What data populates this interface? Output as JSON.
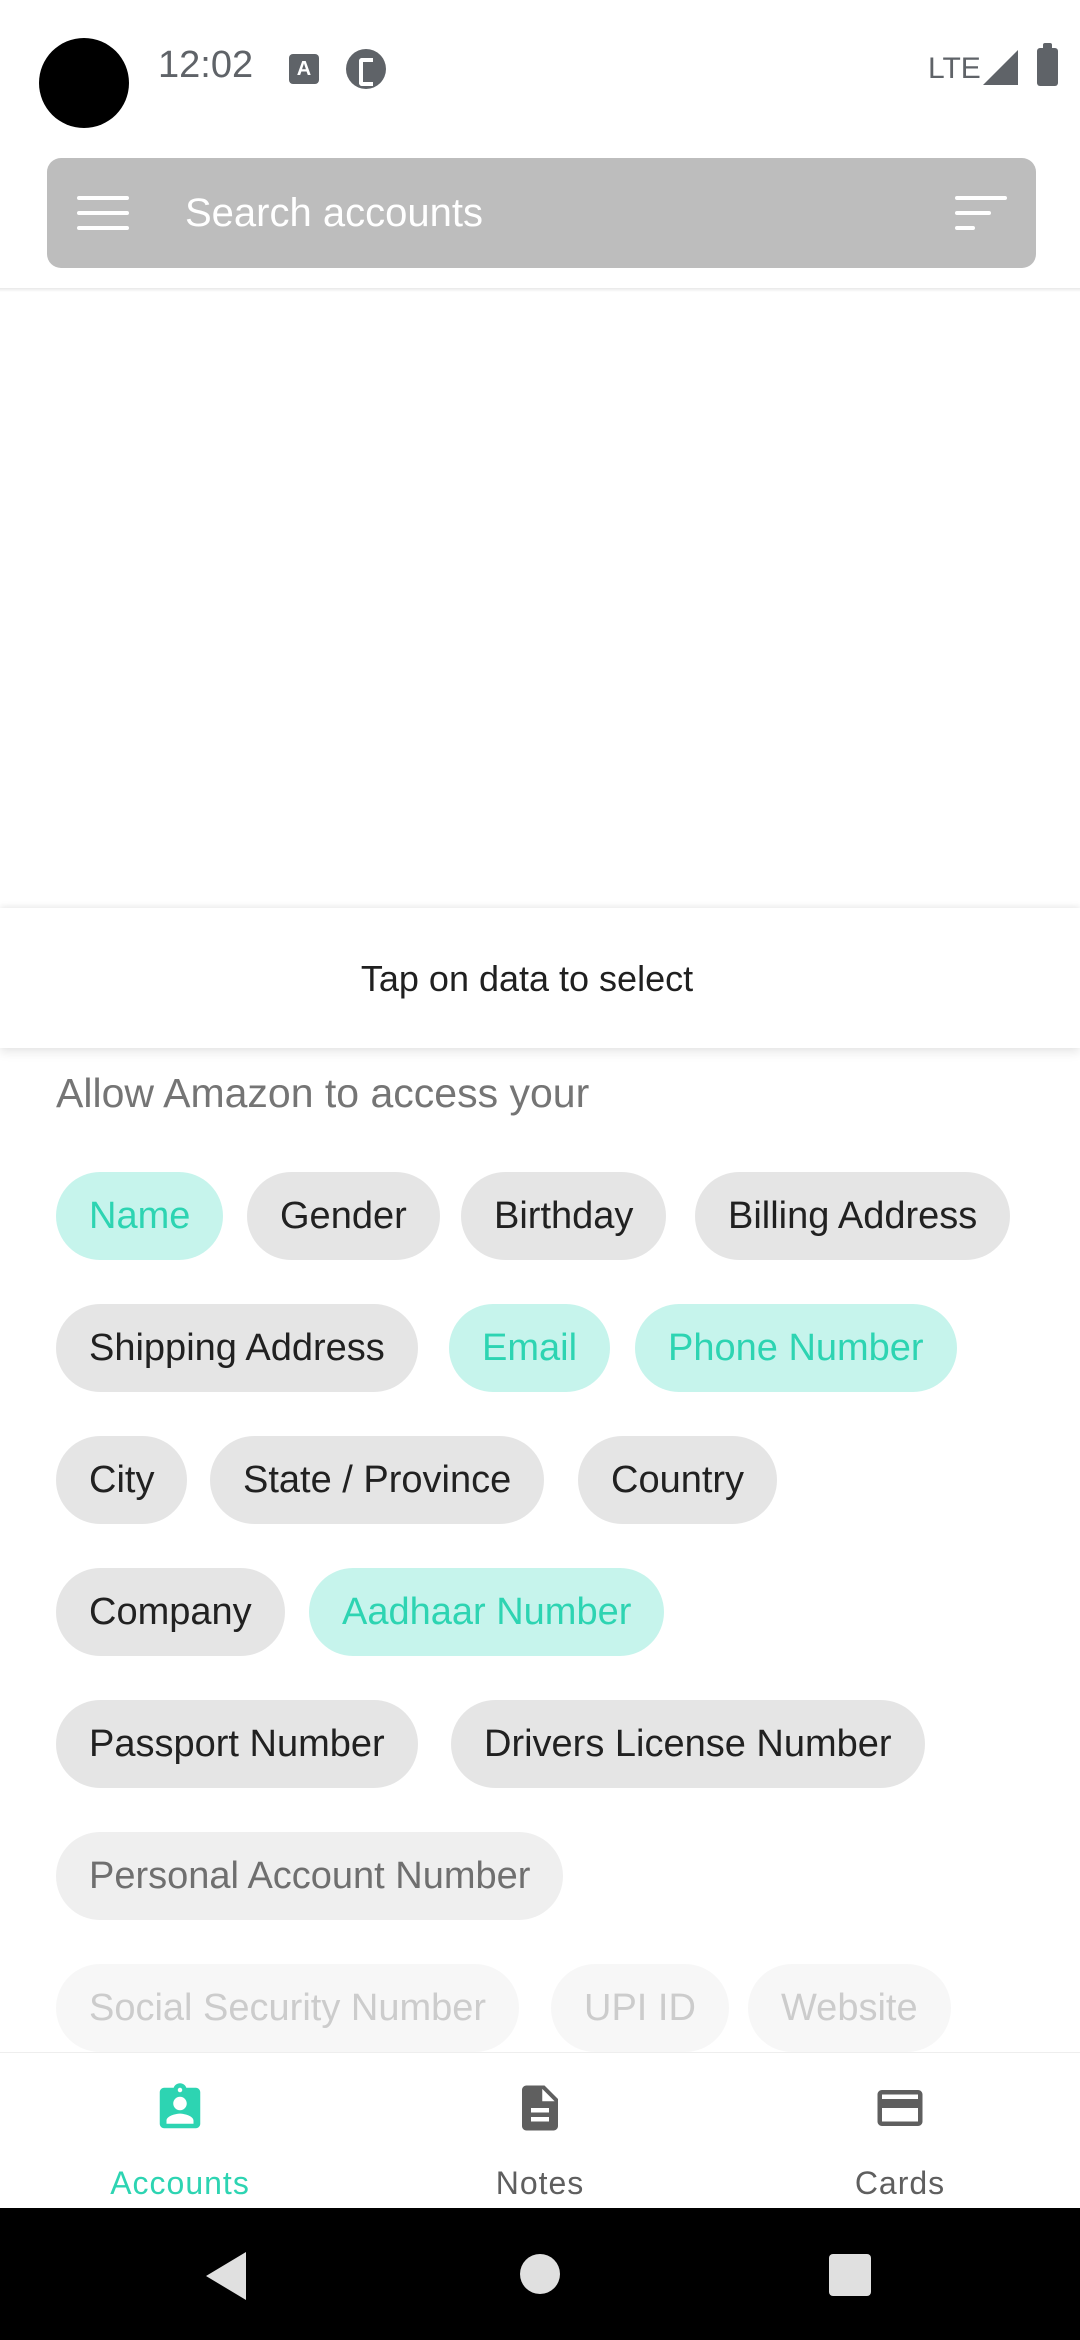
{
  "status_bar": {
    "time": "12:02",
    "network": "LTE",
    "notif_a": "A"
  },
  "search": {
    "placeholder": "Search accounts"
  },
  "sheet": {
    "title": "Tap on data to select",
    "subtitle": "Allow Amazon to access your",
    "chips": [
      {
        "label": "Name",
        "selected": true
      },
      {
        "label": "Gender",
        "selected": false
      },
      {
        "label": "Birthday",
        "selected": false
      },
      {
        "label": "Billing Address",
        "selected": false
      },
      {
        "label": "Shipping Address",
        "selected": false
      },
      {
        "label": "Email",
        "selected": true
      },
      {
        "label": "Phone Number",
        "selected": true
      },
      {
        "label": "City",
        "selected": false
      },
      {
        "label": "State / Province",
        "selected": false
      },
      {
        "label": "Country",
        "selected": false
      },
      {
        "label": "Company",
        "selected": false
      },
      {
        "label": "Aadhaar Number",
        "selected": true
      },
      {
        "label": "Passport Number",
        "selected": false
      },
      {
        "label": "Drivers License Number",
        "selected": false
      },
      {
        "label": "Personal Account Number",
        "selected": false
      },
      {
        "label": "Social Security Number",
        "selected": false
      },
      {
        "label": "UPI ID",
        "selected": false
      },
      {
        "label": "Website",
        "selected": false
      }
    ]
  },
  "bottom_nav": {
    "items": [
      {
        "label": "Accounts",
        "icon": "account-badge-icon",
        "active": true
      },
      {
        "label": "Notes",
        "icon": "note-icon",
        "active": false
      },
      {
        "label": "Cards",
        "icon": "credit-card-icon",
        "active": false
      }
    ]
  },
  "colors": {
    "accent": "#2dd4b2",
    "chip_selected_bg": "#c6f4ec",
    "chip_bg": "#e5e5e5",
    "search_bg": "#bdbdbd"
  }
}
